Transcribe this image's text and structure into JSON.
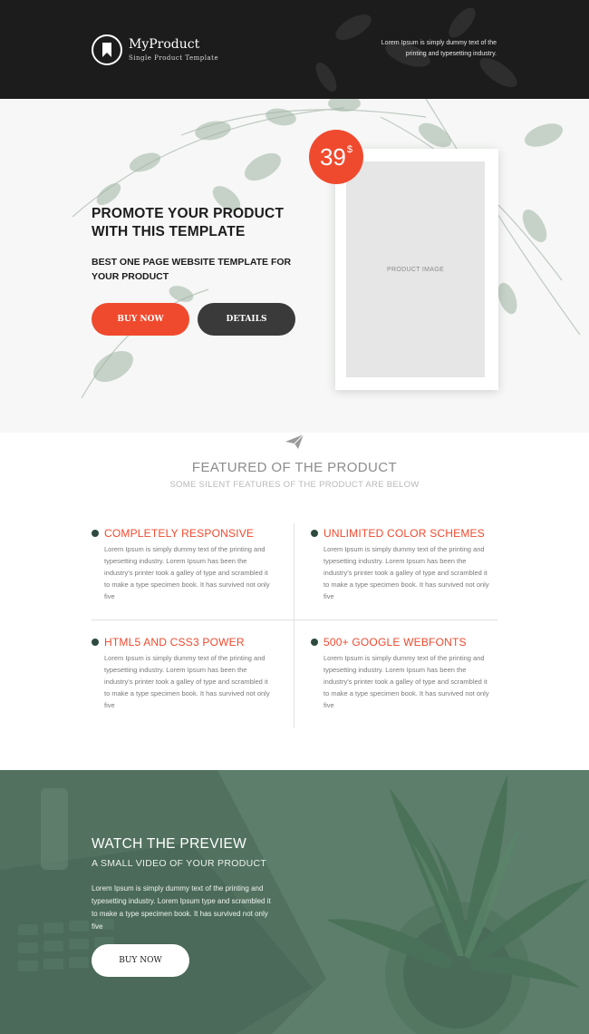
{
  "header": {
    "logo_icon": "bookmark-icon",
    "title": "MyProduct",
    "subtitle": "Single Product Template",
    "tagline": "Lorem Ipsum is simply dummy text of the printing and typesetting industry."
  },
  "hero": {
    "title": "PROMOTE YOUR PRODUCT WITH THIS TEMPLATE",
    "subtitle": "BEST ONE PAGE WEBSITE TEMPLATE FOR YOUR PRODUCT",
    "buy_label": "BUY NOW",
    "details_label": "DETAILS",
    "price": "39",
    "currency": "$",
    "product_image_label": "PRODUCT IMAGE"
  },
  "features": {
    "icon": "paper-plane-icon",
    "title": "FEATURED OF THE PRODUCT",
    "subtitle": "SOME SILENT FEATURES OF THE PRODUCT ARE BELOW",
    "items": [
      {
        "title": "COMPLETELY RESPONSIVE",
        "text": "Lorem Ipsum is simply dummy text of the printing and typesetting industry. Lorem Ipsum has been the industry's printer took a galley of type and scrambled it to make a type specimen book. It has survived not only five"
      },
      {
        "title": "UNLIMITED COLOR SCHEMES",
        "text": "Lorem Ipsum is simply dummy text of the printing and typesetting industry. Lorem Ipsum has been the industry's printer took a galley of type and scrambled it to make a type specimen book. It has survived not only five"
      },
      {
        "title": "HTML5 AND CSS3 POWER",
        "text": "Lorem Ipsum is simply dummy text of the printing and typesetting industry. Lorem Ipsum has been the industry's printer took a galley of type and scrambled it to make a type specimen book. It has survived not only five"
      },
      {
        "title": "500+ GOOGLE WEBFONTS",
        "text": "Lorem Ipsum is simply dummy text of the printing and typesetting industry. Lorem Ipsum has been the industry's printer took a galley of type and scrambled it to make a type specimen book. It has survived not only five"
      }
    ]
  },
  "preview": {
    "title": "WATCH THE PREVIEW",
    "subtitle": "A SMALL VIDEO OF YOUR PRODUCT",
    "text": "Lorem Ipsum is simply dummy text of the printing and typesetting industry. Lorem Ipsum type and scrambled it to make a type specimen book. It has survived not only five",
    "buy_label": "BUY NOW"
  },
  "colors": {
    "accent": "#f04a2e",
    "dark": "#1c1c1c",
    "details_button": "#3a3a3a",
    "preview_bg": "#5d7f6b",
    "bullet": "#2e4a3e"
  }
}
